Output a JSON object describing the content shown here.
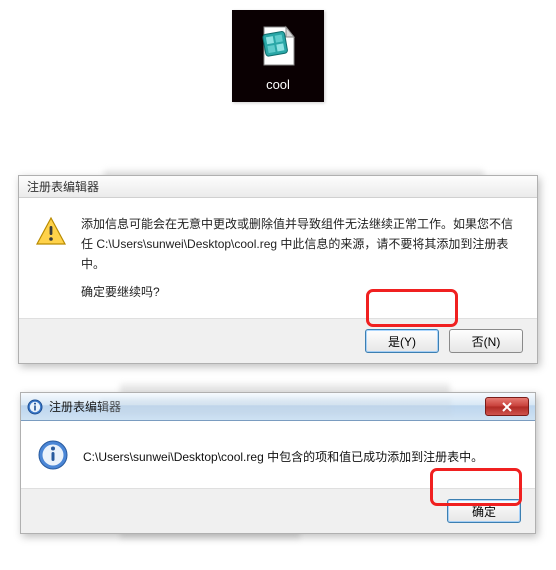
{
  "desktop_icon": {
    "label": "cool",
    "icon_name": "reg-file-icon"
  },
  "dialog1": {
    "title": "注册表编辑器",
    "message_line1": "添加信息可能会在无意中更改或删除值并导致组件无法继续正常工作。如果您不信任 C:\\Users\\sunwei\\Desktop\\cool.reg 中此信息的来源，请不要将其添加到注册表中。",
    "message_line2": "确定要继续吗?",
    "button_yes": "是(Y)",
    "button_no": "否(N)"
  },
  "dialog2": {
    "title": "注册表编辑器",
    "message": "C:\\Users\\sunwei\\Desktop\\cool.reg 中包含的项和值已成功添加到注册表中。",
    "button_ok": "确定"
  }
}
